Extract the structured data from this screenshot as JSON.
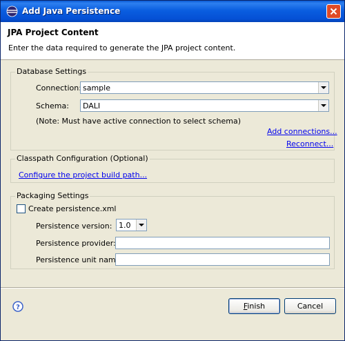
{
  "window": {
    "title": "Add Java Persistence"
  },
  "header": {
    "title": "JPA Project Content",
    "description": "Enter the data required to generate the JPA project content."
  },
  "database_settings": {
    "legend": "Database Settings",
    "connection_label": "Connection:",
    "connection_value": "sample",
    "schema_label": "Schema:",
    "schema_value": "DALI",
    "note": "(Note:  Must have active connection to select schema)",
    "add_connections_link": "Add connections...",
    "reconnect_link": "Reconnect..."
  },
  "classpath": {
    "legend": "Classpath Configuration (Optional)",
    "configure_link": "Configure the project build path..."
  },
  "packaging": {
    "legend": "Packaging Settings",
    "create_xml_label": "Create persistence.xml",
    "create_xml_checked": false,
    "version_label": "Persistence version:",
    "version_value": "1.0",
    "provider_label": "Persistence provider:",
    "provider_value": "",
    "unit_name_label": "Persistence unit name:",
    "unit_name_value": ""
  },
  "footer": {
    "help_icon": "help-icon",
    "finish_mnemonic": "F",
    "finish_rest": "inish",
    "cancel_label": "Cancel"
  },
  "colors": {
    "titlebar": "#0a5ee0",
    "dialog_background": "#ece9d8",
    "link": "#0000ee",
    "close_button": "#e04a26"
  }
}
